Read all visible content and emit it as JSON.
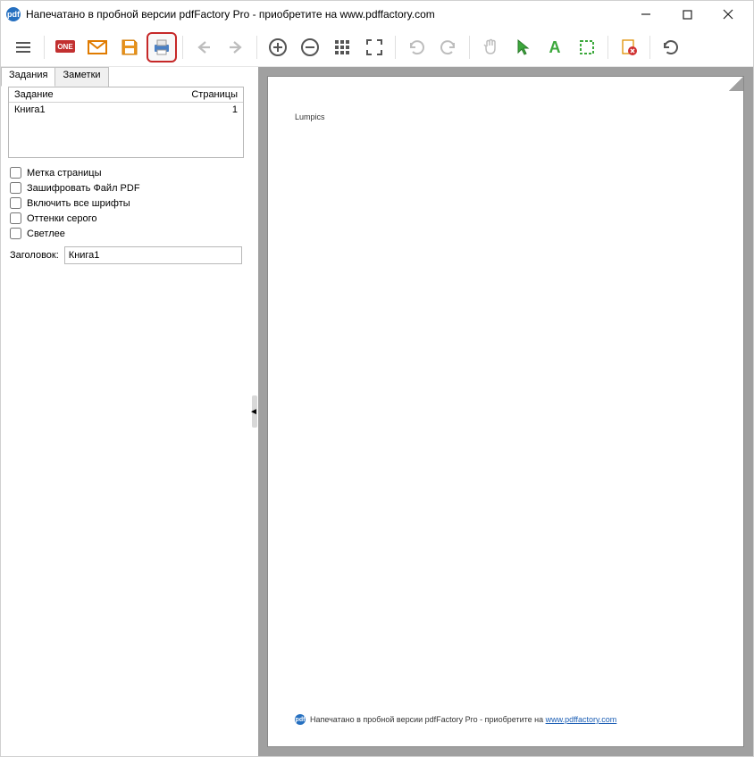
{
  "titlebar": {
    "icon_label": "pdf",
    "title": "Напечатано в пробной версии pdfFactory Pro - приобретите на www.pdffactory.com"
  },
  "toolbar": {
    "menu_icon": "menu-icon",
    "pdf_icon": "pdf-icon",
    "email_icon": "email-icon",
    "save_icon": "save-icon",
    "print_icon": "print-icon",
    "back_icon": "back-icon",
    "forward_icon": "forward-icon",
    "zoom_in_icon": "zoom-in-icon",
    "zoom_out_icon": "zoom-out-icon",
    "thumbnails_icon": "thumbnails-icon",
    "fullscreen_icon": "fullscreen-icon",
    "undo_icon": "undo-icon",
    "redo_icon": "redo-icon",
    "hand_icon": "hand-icon",
    "pointer_icon": "pointer-icon",
    "text_icon": "text-icon",
    "select_icon": "select-icon",
    "delete_icon": "delete-icon",
    "refresh_icon": "refresh-icon"
  },
  "sidebar": {
    "tabs": [
      {
        "label": "Задания",
        "active": true
      },
      {
        "label": "Заметки",
        "active": false
      }
    ],
    "taskbox": {
      "headers": {
        "task": "Задание",
        "pages": "Страницы"
      },
      "rows": [
        {
          "name": "Книга1",
          "pages": "1"
        }
      ]
    },
    "checks": [
      {
        "label": "Метка страницы",
        "checked": false
      },
      {
        "label": "Зашифровать Файл PDF",
        "checked": false
      },
      {
        "label": "Включить все шрифты",
        "checked": false
      },
      {
        "label": "Оттенки серого",
        "checked": false
      },
      {
        "label": "Светлее",
        "checked": false
      }
    ],
    "title_label": "Заголовок:",
    "title_value": "Книга1"
  },
  "preview": {
    "page_text": "Lumpics",
    "footer_icon": "pdf",
    "footer_text": "Напечатано в пробной версии pdfFactory Pro - приобретите на ",
    "footer_link": "www.pdffactory.com"
  }
}
